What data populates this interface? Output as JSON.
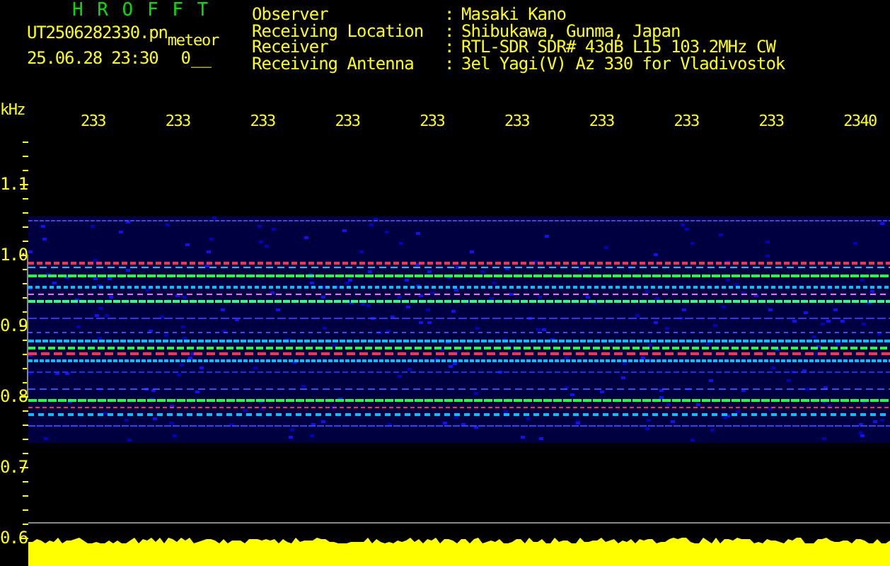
{
  "app_title": "H R O F F T",
  "file_name": "UT2506282330.pn",
  "mode": "meteor",
  "date_time": "25.06.28 23:30",
  "count": "0__",
  "info": [
    {
      "label": "Observer",
      "separator": ":",
      "value": "Masaki Kano"
    },
    {
      "label": "Receiving Location",
      "separator": ":",
      "value": "Shibukawa, Gunma, Japan"
    },
    {
      "label": "Receiver",
      "separator": ":",
      "value": "RTL-SDR SDR# 43dB L15 103.2MHz CW"
    },
    {
      "label": "Receiving Antenna",
      "separator": ":",
      "value": "3el Yagi(V) Az 330 for Vladivostok"
    }
  ],
  "plot": {
    "y_unit": "kHz",
    "time_labels": [
      "233",
      "233",
      "233",
      "233",
      "233",
      "233",
      "233",
      "233",
      "233",
      "2340"
    ],
    "frequency_labels": [
      "1.1",
      "1.0",
      "0.9",
      "0.8",
      "0.7",
      "0.6"
    ]
  }
}
